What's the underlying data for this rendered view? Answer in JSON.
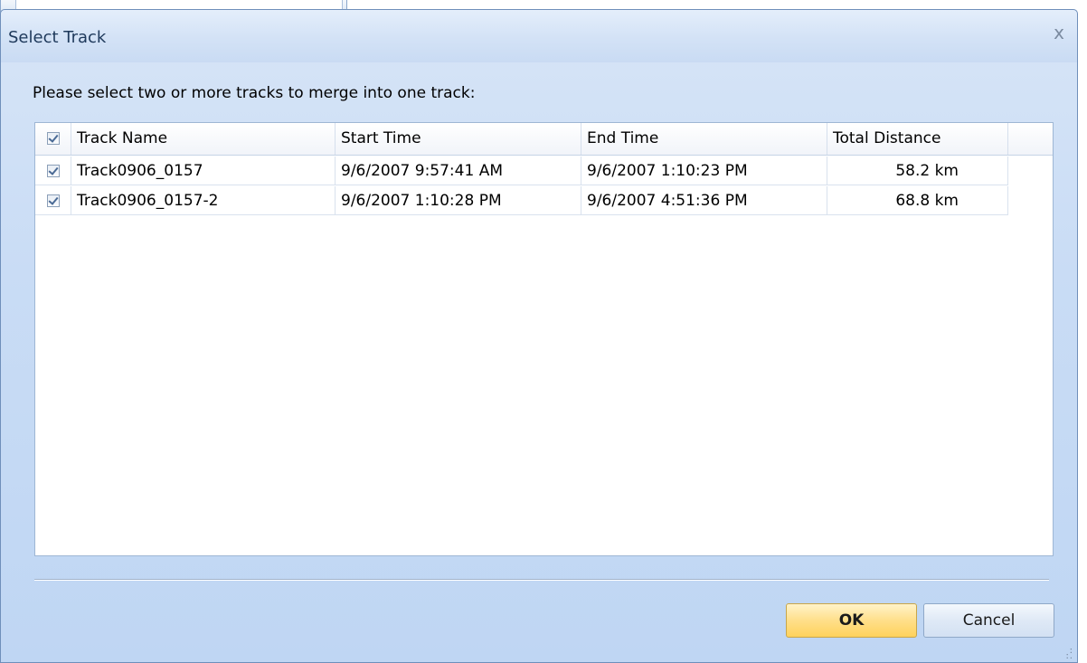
{
  "dialog": {
    "title": "Select Track",
    "close_glyph": "x",
    "instruction": "Please select two or more tracks to merge into one track:"
  },
  "list": {
    "columns": [
      "Track Name",
      "Start Time",
      "End Time",
      "Total Distance"
    ],
    "header_checked": true,
    "rows": [
      {
        "checked": true,
        "name": "Track0906_0157",
        "start": "9/6/2007 9:57:41 AM",
        "end": "9/6/2007 1:10:23 PM",
        "distance": "58.2 km"
      },
      {
        "checked": true,
        "name": "Track0906_0157-2",
        "start": "9/6/2007 1:10:28 PM",
        "end": "9/6/2007 4:51:36 PM",
        "distance": "68.8 km"
      }
    ]
  },
  "buttons": {
    "ok": "OK",
    "cancel": "Cancel"
  },
  "icons": {
    "close": "close-icon",
    "checkbox": "checkbox-checked-icon",
    "grip": "resize-grip-icon"
  },
  "colors": {
    "ok_button": "#ffdf8a",
    "dialog_bg": "#c9dcf5"
  }
}
